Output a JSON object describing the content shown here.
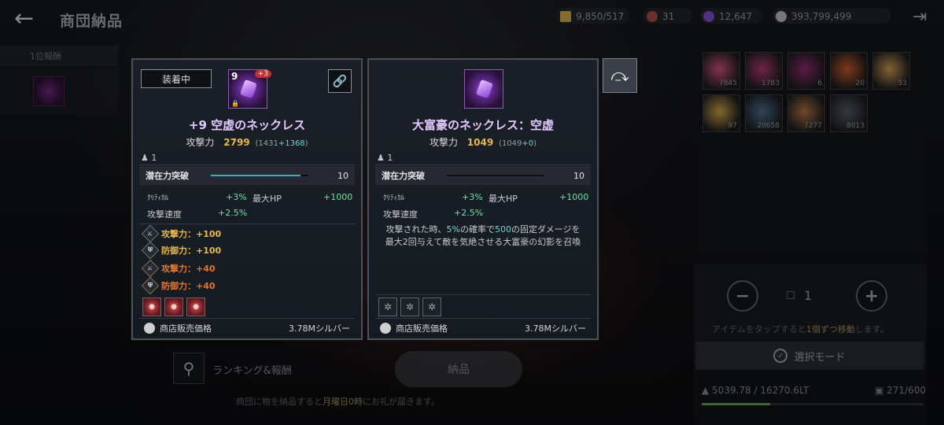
{
  "header": {
    "title": "商団納品",
    "currencies": [
      {
        "icon": "gold-bar-icon",
        "value": "9,850/517",
        "color": "#c8a848"
      },
      {
        "icon": "red-orb-icon",
        "value": "31",
        "color": "#a24a44"
      },
      {
        "icon": "purple-gem-icon",
        "value": "12,647",
        "color": "#7a4ac6"
      },
      {
        "icon": "silver-coin-icon",
        "value": "393,799,499",
        "color": "#b7b7b7"
      }
    ]
  },
  "left": {
    "rank_tab": "1位報酬",
    "search_label": "ランキング&報酬",
    "submit_label": "納品",
    "notice_parts": [
      "商団に物を納品すると",
      "月曜日0時",
      "にお礼が届きます。"
    ]
  },
  "equipped_card": {
    "badge": "装着中",
    "icon_level": "9",
    "icon_plus": "+3",
    "name": "+9 空虚のネックレス",
    "atk_label": "攻撃力",
    "atk_value": "2799",
    "atk_base": "1431",
    "atk_bonus": "+1368",
    "owner_count": "1",
    "potential_label": "潜在力突破",
    "potential_value": "10",
    "potential_fill": 0.92,
    "stats": [
      {
        "label": "ｸﾘﾃｨｶﾙ",
        "value": "+3%"
      },
      {
        "label": "最大HP",
        "value": "+1000"
      },
      {
        "label": "攻撃速度",
        "value": "+2.5%"
      }
    ],
    "options": [
      {
        "text": "攻撃力：+100",
        "color": "#e6b94a"
      },
      {
        "text": "防御力：+100",
        "color": "#e6b94a"
      },
      {
        "text": "攻撃力：+40",
        "color": "#e0762e"
      },
      {
        "text": "防御力：+40",
        "color": "#e0762e"
      }
    ],
    "price_label": "商店販売価格",
    "price_value": "3.78Mシルバー"
  },
  "compare_card": {
    "name": "大富豪のネックレス：空虚",
    "atk_label": "攻撃力",
    "atk_value": "1049",
    "atk_base": "1049",
    "atk_bonus": "+0",
    "owner_count": "1",
    "potential_label": "潜在力突破",
    "potential_value": "10",
    "potential_fill": 1.0,
    "stats": [
      {
        "label": "ｸﾘﾃｨｶﾙ",
        "value": "+3%"
      },
      {
        "label": "最大HP",
        "value": "+1000"
      },
      {
        "label": "攻撃速度",
        "value": "+2.5%"
      }
    ],
    "desc_parts": [
      "攻撃された時、",
      "5%",
      "の確率で",
      "500",
      "の固定ダメージを",
      "最大2回与えて敵を気絶させる大富豪の幻影を召喚"
    ],
    "price_label": "商店販売価格",
    "price_value": "3.78Mシルバー"
  },
  "inventory": {
    "slots": [
      {
        "count": "7845",
        "color": "#c9507a"
      },
      {
        "count": "1783",
        "color": "#a93a6a"
      },
      {
        "count": "6",
        "color": "#8a2a6a"
      },
      {
        "count": "20",
        "color": "#c0582a"
      },
      {
        "count": "53",
        "color": "#c99850"
      },
      {
        "count": "97",
        "color": "#c9a048"
      },
      {
        "count": "20658",
        "color": "#4a6a8a"
      },
      {
        "count": "7277",
        "color": "#a87040"
      },
      {
        "count": "8013",
        "color": "#505860"
      }
    ],
    "quantity": "1",
    "tap_hint_parts": [
      "アイテムをタップすると",
      "1個ずつ移動",
      "します。"
    ],
    "select_mode": "選択モード",
    "weight": "5039.78 / 16270.6LT",
    "slot_count": "271/600",
    "weight_fill": 0.31
  }
}
